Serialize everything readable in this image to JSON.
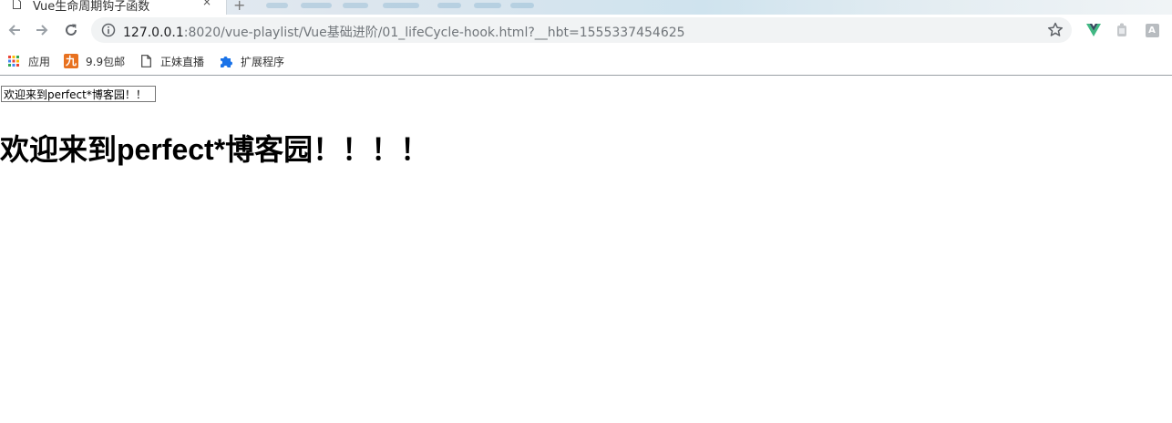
{
  "tab": {
    "title": "Vue生命周期钩子函数",
    "close_glyph": "×",
    "new_tab_glyph": "+"
  },
  "toolbar": {
    "url_host": "127.0.0.1",
    "url_rest": ":8020/vue-playlist/Vue基础进阶/01_lifeCycle-hook.html?__hbt=1555337454625"
  },
  "extensions": {
    "vue_devtools_icon": "vue-devtools-icon",
    "extension2_icon": "puzzle-gray-icon",
    "extension3_label": "A"
  },
  "bookmarks": [
    {
      "label": "应用",
      "icon": "apps-grid-icon"
    },
    {
      "label": "9.9包邮",
      "icon": "jiu-logo-icon",
      "icon_text": "九"
    },
    {
      "label": "正妹直播",
      "icon": "page-icon"
    },
    {
      "label": "扩展程序",
      "icon": "puzzle-icon"
    }
  ],
  "page": {
    "input_value": "欢迎来到perfect*博客园！！",
    "heading": "欢迎来到perfect*博客园！！！！"
  },
  "colors": {
    "vue_green": "#41b883",
    "jiu_orange": "#e8711f",
    "puzzle_blue": "#1a73e8"
  }
}
